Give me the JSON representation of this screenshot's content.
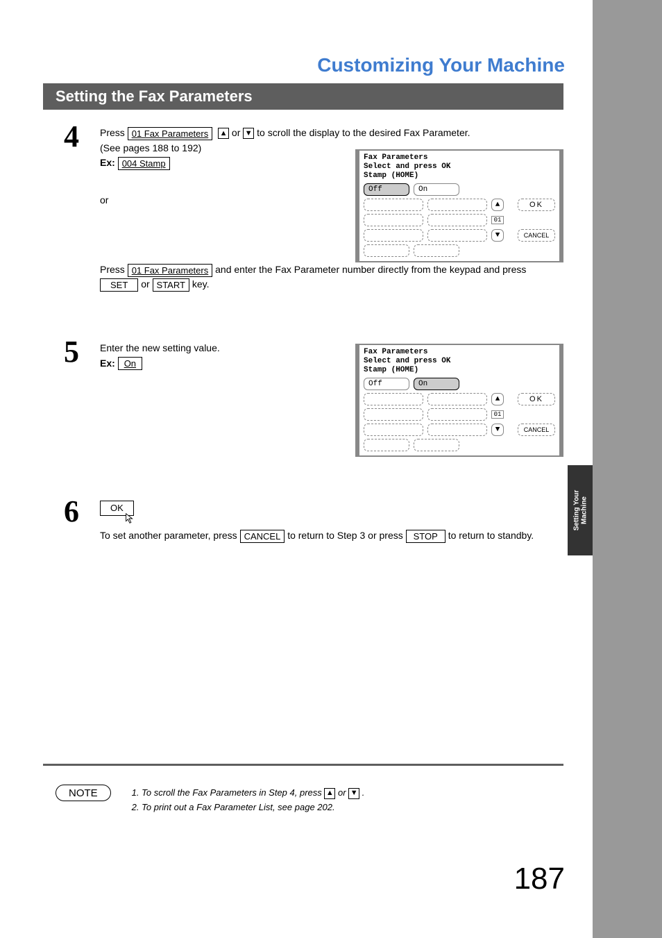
{
  "page_title": "Customizing Your Machine",
  "section": "Setting the Fax Parameters",
  "side_tab": "Setting Your\nMachine",
  "page_number": "187",
  "arrows": {
    "up": "▲",
    "down": "▼"
  },
  "steps": {
    "s4": {
      "num": "4",
      "t1": "Press ",
      "btn1": "01 Fax Parameters",
      "t2": " or ",
      "t3": " to scroll the display to the desired Fax Parameter.",
      "see": "(See pages 188 to 192)",
      "ex_label": "Ex:",
      "ex_btn": "004 Stamp",
      "or": "or",
      "t4": "Press ",
      "btn2": "01 Fax Parameters",
      "t5": " and enter the Fax Parameter number directly from the keypad and press ",
      "set": "SET",
      "t6": " or ",
      "start": "START",
      "t7": " key."
    },
    "s5": {
      "num": "5",
      "t1": "Enter the new setting value.",
      "ex_label": "Ex:",
      "ex_btn": "On"
    },
    "s6": {
      "num": "6",
      "ok": "OK",
      "t1": "To  set  another  parameter,  press ",
      "cancel": "CANCEL",
      "t2": " to  return  to  Step  3  or  press ",
      "stop": "STOP",
      "t3": " to return to standby."
    }
  },
  "lcd1": {
    "hdr": "Fax Parameters\nSelect and press OK\nStamp (HOME)",
    "off": "Off",
    "on": "On",
    "ok": "OK",
    "cancel": "CANCEL",
    "idx": "01"
  },
  "lcd2": {
    "hdr": "Fax Parameters\nSelect and press OK\nStamp (HOME)",
    "off": "Off",
    "on": "On",
    "ok": "OK",
    "cancel": "CANCEL",
    "idx": "01"
  },
  "notes": {
    "label": "NOTE",
    "n1a": "1. To scroll the Fax Parameters in Step 4, press ",
    "n1b": " or ",
    "n1c": ".",
    "n2": "2. To print out a Fax Parameter List, see page 202."
  }
}
